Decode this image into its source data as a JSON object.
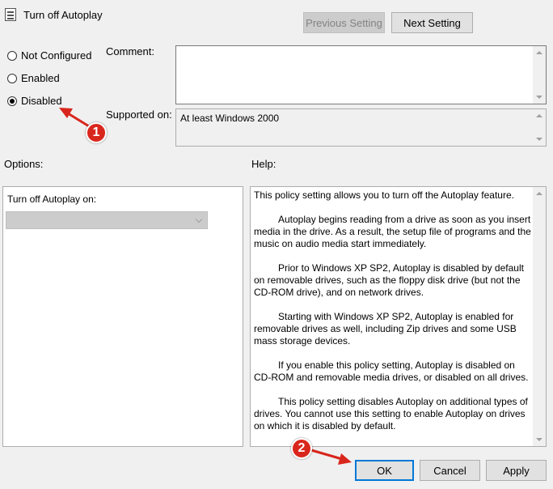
{
  "window": {
    "title": "Turn off Autoplay",
    "icon": "policy-document-icon"
  },
  "nav": {
    "previous_label": "Previous Setting",
    "next_label": "Next Setting"
  },
  "state": {
    "options": [
      {
        "label": "Not Configured",
        "checked": false
      },
      {
        "label": "Enabled",
        "checked": false
      },
      {
        "label": "Disabled",
        "checked": true
      }
    ]
  },
  "comment": {
    "label": "Comment:",
    "value": ""
  },
  "supported": {
    "label": "Supported on:",
    "value": "At least Windows 2000"
  },
  "options_panel": {
    "heading": "Options:",
    "field_label": "Turn off Autoplay on:",
    "select_value": ""
  },
  "help_panel": {
    "heading": "Help:",
    "paragraphs": [
      "This policy setting allows you to turn off the Autoplay feature.",
      "Autoplay begins reading from a drive as soon as you insert media in the drive. As a result, the setup file of programs and the music on audio media start immediately.",
      "Prior to Windows XP SP2, Autoplay is disabled by default on removable drives, such as the floppy disk drive (but not the CD-ROM drive), and on network drives.",
      "Starting with Windows XP SP2, Autoplay is enabled for removable drives as well, including Zip drives and some USB mass storage devices.",
      "If you enable this policy setting, Autoplay is disabled on CD-ROM and removable media drives, or disabled on all drives.",
      "This policy setting disables Autoplay on additional types of drives. You cannot use this setting to enable Autoplay on drives on which it is disabled by default."
    ]
  },
  "footer": {
    "ok_label": "OK",
    "cancel_label": "Cancel",
    "apply_label": "Apply"
  },
  "annotations": {
    "badge1": "1",
    "badge2": "2",
    "accent_color": "#d9261c"
  }
}
